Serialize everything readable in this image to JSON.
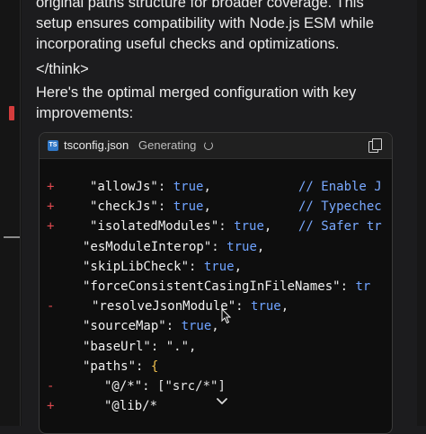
{
  "message": {
    "lines_top": [
      "original paths structure for broader coverage. This",
      "setup ensures compatibility with Node.js ESM while",
      "incorporating useful checks and optimizations."
    ],
    "think_close": "</think>",
    "intro_lines": [
      "Here's the optimal merged configuration with key",
      "improvements:"
    ]
  },
  "codeblock": {
    "filename": "tsconfig.json",
    "status": "Generating",
    "badge": "TS",
    "icons": {
      "copy": "copy-icon",
      "spinner": "spinner-icon",
      "expand": "chevron-down-icon"
    },
    "lines": [
      {
        "marker": "+",
        "key": "\"allowJs\"",
        "sep": ": ",
        "value": "true",
        "tail": ",",
        "comment": "// Enable J"
      },
      {
        "marker": "+",
        "key": "\"checkJs\"",
        "sep": ": ",
        "value": "true",
        "tail": ",",
        "comment": "// Typechec"
      },
      {
        "marker": "+",
        "key": "\"isolatedModules\"",
        "sep": ": ",
        "value": "true",
        "tail": ",",
        "comment": "// Safer tr"
      },
      {
        "marker": "",
        "key": "\"esModuleInterop\"",
        "sep": ": ",
        "value": "true",
        "tail": ",",
        "comment": ""
      },
      {
        "marker": "",
        "key": "\"skipLibCheck\"",
        "sep": ": ",
        "value": "true",
        "tail": ",",
        "comment": ""
      },
      {
        "marker": "",
        "key": "\"forceConsistentCasingInFileNames\"",
        "sep": ": ",
        "value": "tr",
        "tail": "",
        "comment": ""
      },
      {
        "marker": "-",
        "key": "\"resolveJsonModule\"",
        "sep": ": ",
        "value": "true",
        "tail": ",",
        "comment": ""
      },
      {
        "marker": "",
        "key": "\"sourceMap\"",
        "sep": ": ",
        "value": "true",
        "tail": ",",
        "comment": ""
      },
      {
        "marker": "",
        "key": "\"baseUrl\"",
        "sep": ": ",
        "value": "\".\"",
        "tail": ",",
        "comment": ""
      },
      {
        "marker": "",
        "key": "\"paths\"",
        "sep": ": ",
        "value": "{",
        "tail": "",
        "comment": ""
      },
      {
        "marker": "-",
        "key": "\"@/*\"",
        "sep": ": ",
        "value": "[\"src/*\"]",
        "tail": "",
        "comment": ""
      },
      {
        "marker": "+",
        "key": "\"@lib/*",
        "sep": "",
        "value": "",
        "tail": "",
        "comment": ""
      }
    ]
  },
  "colors": {
    "diff_marker": "#e0494f",
    "boolean": "#6fa3ff",
    "comment": "#79a9ff",
    "brace": "#f2c14e",
    "ts_badge": "#3178c6"
  }
}
